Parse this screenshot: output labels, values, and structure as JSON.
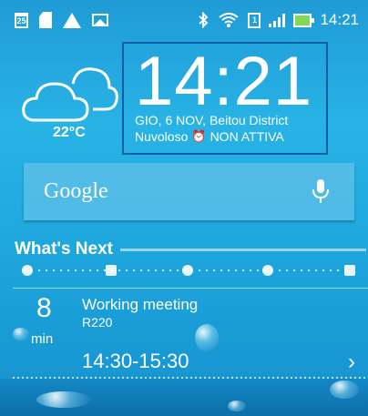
{
  "status_bar": {
    "calendar_day": "25",
    "icons": [
      "calendar-icon",
      "sd-card-icon",
      "warning-icon",
      "image-icon",
      "bluetooth-icon",
      "wifi-icon",
      "sim-icon",
      "signal-icon",
      "battery-charging-icon"
    ],
    "sim_number": "1",
    "time": "14:21"
  },
  "weather": {
    "icon": "cloud-icon",
    "temperature": "22°C"
  },
  "clock": {
    "time": "14:21",
    "date_location": "GIO, 6 NOV, Beitou District",
    "condition": "Nuvoloso",
    "alarm_icon": "alarm-icon",
    "alarm_status": "NON ATTIVA"
  },
  "search": {
    "label": "Google",
    "mic_icon": "mic-icon"
  },
  "whats_next": {
    "title": "What's Next",
    "timeline_icons": [
      "clock-icon",
      "gift-icon",
      "clock-icon",
      "people-icon",
      "mail-icon"
    ],
    "event": {
      "count": "8",
      "unit": "min",
      "title": "Working meeting",
      "location": "R220",
      "time_range": "14:30-15:30"
    }
  },
  "colors": {
    "background": "#22a9e0",
    "clock_border": "#0f5fa8",
    "battery_fill": "#7ed957"
  }
}
